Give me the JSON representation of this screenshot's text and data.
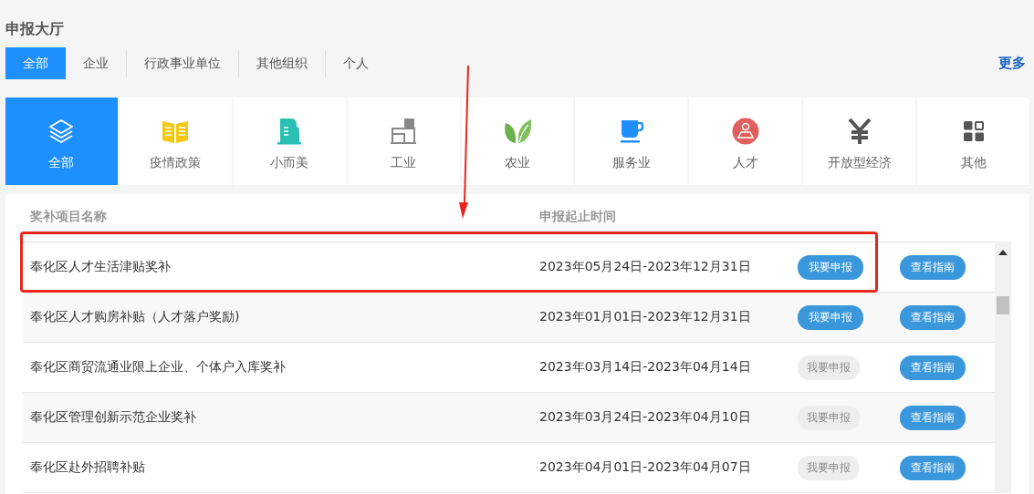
{
  "title": "申报大厅",
  "filters": [
    {
      "label": "全部",
      "selected": true
    },
    {
      "label": "企业",
      "selected": false
    },
    {
      "label": "行政事业单位",
      "selected": false
    },
    {
      "label": "其他组织",
      "selected": false
    },
    {
      "label": "个人",
      "selected": false
    }
  ],
  "more_link": "更多",
  "categories": [
    {
      "label": "全部",
      "selected": true
    },
    {
      "label": "疫情政策",
      "selected": false
    },
    {
      "label": "小而美",
      "selected": false
    },
    {
      "label": "工业",
      "selected": false
    },
    {
      "label": "农业",
      "selected": false
    },
    {
      "label": "服务业",
      "selected": false
    },
    {
      "label": "人才",
      "selected": false
    },
    {
      "label": "开放型经济",
      "selected": false
    },
    {
      "label": "其他",
      "selected": false
    }
  ],
  "table": {
    "columns": [
      "奖补项目名称",
      "申报起止时间"
    ],
    "rows": [
      {
        "name": "奉化区人才生活津贴奖补",
        "period": "2023年05月24日-2023年12月31日",
        "apply": {
          "label": "我要申报",
          "disabled": false
        },
        "guide": "查看指南",
        "highlighted": true
      },
      {
        "name": "奉化区人才购房补贴（人才落户奖励)",
        "period": "2023年01月01日-2023年12月31日",
        "apply": {
          "label": "我要申报",
          "disabled": false
        },
        "guide": "查看指南",
        "highlighted": false
      },
      {
        "name": "奉化区商贸流通业限上企业、个体户入库奖补",
        "period": "2023年03月14日-2023年04月14日",
        "apply": {
          "label": "我要申报",
          "disabled": true
        },
        "guide": "查看指南",
        "highlighted": false
      },
      {
        "name": "奉化区管理创新示范企业奖补",
        "period": "2023年03月24日-2023年04月10日",
        "apply": {
          "label": "我要申报",
          "disabled": true
        },
        "guide": "查看指南",
        "highlighted": false
      },
      {
        "name": "奉化区赴外招聘补贴",
        "period": "2023年04月01日-2023年04月07日",
        "apply": {
          "label": "我要申报",
          "disabled": true
        },
        "guide": "查看指南",
        "highlighted": false
      }
    ]
  }
}
